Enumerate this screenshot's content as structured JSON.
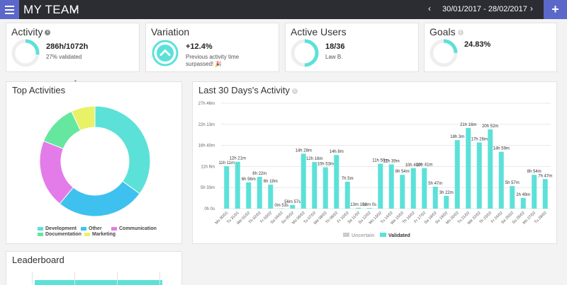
{
  "header": {
    "title": "MY TEAM",
    "date_range": "30/01/2017 - 28/02/2017",
    "prev_label": "‹",
    "next_label": "›",
    "add_label": "+"
  },
  "cards": {
    "activity": {
      "title": "Activity",
      "value": "286h/1072h",
      "sub": "27% validated",
      "progress": 0.27,
      "color": "#5ce1d9"
    },
    "variation": {
      "title": "Variation",
      "value": "+12.4%",
      "sub_line1": "Previous activity time",
      "sub_line2": "surpassed! 🎉",
      "color": "#5ce1d9"
    },
    "active_users": {
      "title": "Active Users",
      "value": "18/36",
      "sub": "Law B.",
      "progress": 0.5,
      "color": "#5ce1d9"
    },
    "goals": {
      "title": "Goals",
      "value": "24.83%",
      "progress": 0.2483,
      "color": "#5ce1d9"
    }
  },
  "top_activities": {
    "title": "Top Activities",
    "chart_data": {
      "type": "pie",
      "title": "Top Activities",
      "slices": [
        {
          "label": "Development",
          "value": 35,
          "color": "#5ce1d9"
        },
        {
          "label": "Other",
          "value": 26,
          "color": "#3fc1ef"
        },
        {
          "label": "Communication",
          "value": 20,
          "color": "#e37ce9"
        },
        {
          "label": "Documentation",
          "value": 12,
          "color": "#66e7a0"
        },
        {
          "label": "Marketing",
          "value": 7,
          "color": "#e9f266"
        }
      ],
      "legend_position": "bottom"
    }
  },
  "last30": {
    "title": "Last 30 Days's Activity",
    "chart_data": {
      "type": "bar",
      "title": "Last 30 Days's Activity",
      "y_ticks": [
        "0h 0s",
        "5h 33m",
        "11h 6m",
        "16h 40m",
        "22h 13m",
        "27h 46m"
      ],
      "ylim": [
        0,
        27.77
      ],
      "categories": [
        "Mo 30/01",
        "Tu 31/01",
        "We 01/02",
        "Th 02/02",
        "Fr 03/02",
        "Sa 04/02",
        "Su 05/02",
        "Mo 06/02",
        "Tu 07/02",
        "We 08/02",
        "Th 09/02",
        "Fr 10/02",
        "Sa 11/02",
        "Su 12/02",
        "Mo 13/02",
        "Tu 14/02",
        "We 15/02",
        "Th 16/02",
        "Fr 17/02",
        "Sa 18/02",
        "Su 19/02",
        "Mo 20/02",
        "Tu 21/02",
        "We 22/02",
        "Th 23/02",
        "Fr 24/02",
        "Sa 25/02",
        "Su 26/02",
        "Mo 27/02",
        "Tu 28/02"
      ],
      "series": [
        {
          "name": "Uncertain",
          "color": "#cccccc",
          "values": [
            0,
            0,
            0,
            0,
            0,
            0,
            0,
            0,
            0,
            0,
            0,
            0,
            0,
            0,
            0,
            0,
            0,
            0,
            0,
            0,
            0,
            0,
            0,
            0,
            0,
            0,
            0,
            0,
            0,
            0
          ]
        },
        {
          "name": "Validated",
          "color": "#5ce1d9",
          "values": [
            11.18,
            12.35,
            6.93,
            8.37,
            6.32,
            0.02,
            0.95,
            14.47,
            12.27,
            10.88,
            14.13,
            7.08,
            0.22,
            0.17,
            11.83,
            11.65,
            8.9,
            10.67,
            10.68,
            5.78,
            3.37,
            18.05,
            21.27,
            17.43,
            20.87,
            14.98,
            5.95,
            2.82,
            8.9,
            7.78
          ],
          "labels": [
            "11h 11m",
            "12h 21m",
            "6h 56m",
            "8h 22m",
            "6h 19m",
            "0m 53s",
            "56m 57s",
            "14h 28m",
            "12h 16m",
            "10h 53m",
            "14h 8m",
            "7h 5m",
            "13m 10s",
            "10m 0s",
            "11h 50m",
            "11h 39m",
            "8h 54m",
            "10h 40m",
            "10h 41m",
            "5h 47m",
            "3h 22m",
            "18h 3m",
            "21h 16m",
            "17h 26m",
            "20h 52m",
            "14h 59m",
            "5h 57m",
            "2h 49m",
            "8h 54m",
            "7h 47m"
          ]
        }
      ],
      "legend": [
        "Uncertain",
        "Validated"
      ],
      "legend_position": "bottom"
    }
  },
  "leaderboard": {
    "title": "Leaderboard"
  }
}
